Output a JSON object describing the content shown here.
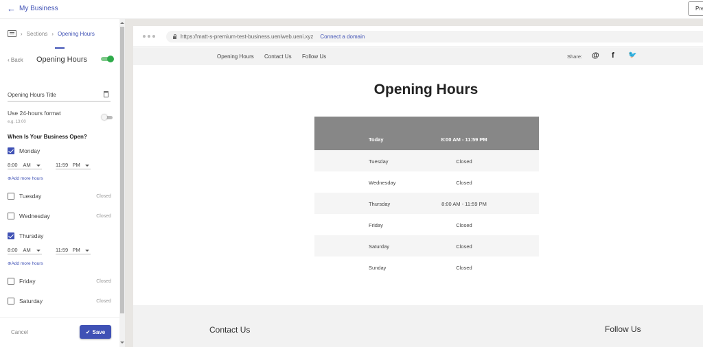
{
  "topbar": {
    "back_label": "My Business",
    "preview_label": "Pre"
  },
  "sidebar": {
    "breadcrumb": {
      "sections": "Sections",
      "current": "Opening Hours"
    },
    "back_label": "Back",
    "section_title": "Opening Hours",
    "title_field_value": "Opening Hours Title",
    "format_label": "Use 24-hours format",
    "format_hint": "e.g. 13:00",
    "when_label": "When Is Your Business Open?",
    "add_more_label": "Add more hours",
    "days": [
      {
        "name": "Monday",
        "checked": true,
        "open": "8:00",
        "open_ampm": "AM",
        "close": "11:59",
        "close_ampm": "PM"
      },
      {
        "name": "Tuesday",
        "checked": false,
        "status": "Closed"
      },
      {
        "name": "Wednesday",
        "checked": false,
        "status": "Closed"
      },
      {
        "name": "Thursday",
        "checked": true,
        "open": "8:00",
        "open_ampm": "AM",
        "close": "11:59",
        "close_ampm": "PM"
      },
      {
        "name": "Friday",
        "checked": false,
        "status": "Closed"
      },
      {
        "name": "Saturday",
        "checked": false,
        "status": "Closed"
      }
    ],
    "cancel_label": "Cancel",
    "save_label": "Save"
  },
  "browser": {
    "url": "https://matt-s-premium-test-business.ueniweb.ueni.xyz",
    "connect_label": "Connect a domain"
  },
  "site": {
    "nav": [
      "Opening Hours",
      "Contact Us",
      "Follow Us"
    ],
    "share_label": "Share:",
    "social": {
      "email": "@",
      "facebook": "f",
      "twitter": "🐦"
    },
    "hours_title": "Opening Hours",
    "hours": [
      {
        "day": "Today",
        "time": "8:00 AM - 11:59 PM"
      },
      {
        "day": "Tuesday",
        "time": "Closed"
      },
      {
        "day": "Wednesday",
        "time": "Closed"
      },
      {
        "day": "Thursday",
        "time": "8:00 AM - 11:59 PM"
      },
      {
        "day": "Friday",
        "time": "Closed"
      },
      {
        "day": "Saturday",
        "time": "Closed"
      },
      {
        "day": "Sunday",
        "time": "Closed"
      }
    ],
    "footer": {
      "contact": "Contact Us",
      "follow": "Follow Us"
    }
  },
  "colors": {
    "accent": "#3f51b5",
    "toggle_on": "#2eab4a",
    "table_header": "#878787"
  }
}
